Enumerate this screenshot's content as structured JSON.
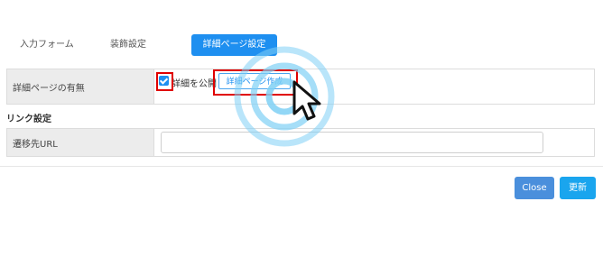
{
  "tabs": [
    {
      "label": "入力フォーム"
    },
    {
      "label": "装飾設定"
    },
    {
      "label": "詳細ページ設定"
    }
  ],
  "detail_row": {
    "label": "詳細ページの有無",
    "checkbox_label": "詳細を公開",
    "checkbox_checked": true,
    "button_label": "詳細ページ作成"
  },
  "link_section": {
    "title": "リンク設定",
    "url_label": "遷移先URL",
    "url_value": ""
  },
  "footer": {
    "close_label": "Close",
    "update_label": "更新"
  },
  "colors": {
    "accent": "#1e8ff0",
    "highlight": "#e00000",
    "close_button": "#4a8fdc",
    "update_button": "#1aa5ee",
    "ripple": "#7fd0f5"
  }
}
